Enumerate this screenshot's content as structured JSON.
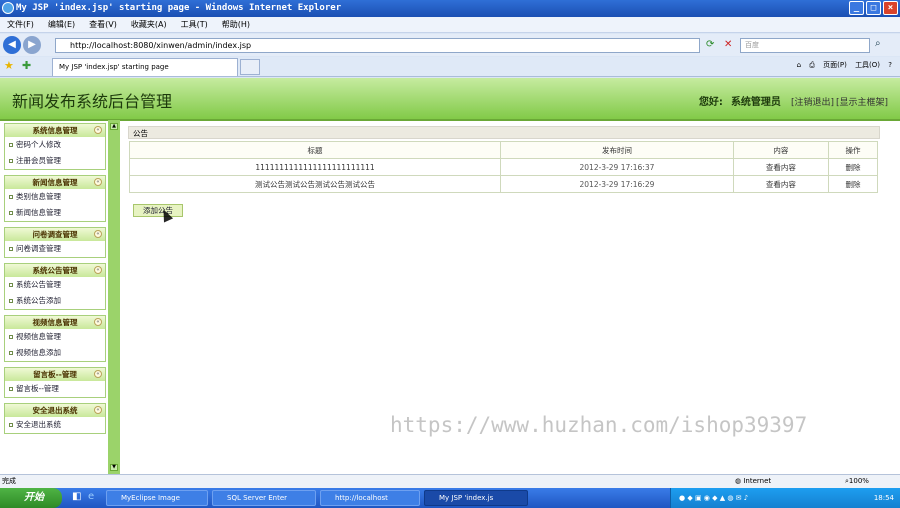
{
  "window": {
    "title": "My JSP 'index.jsp' starting page - Windows Internet Explorer"
  },
  "menu": [
    "文件(F)",
    "编辑(E)",
    "查看(V)",
    "收藏夹(A)",
    "工具(T)",
    "帮助(H)"
  ],
  "address": {
    "url": "http://localhost:8080/xinwen/admin/index.jsp",
    "search_placeholder": "百度"
  },
  "tab": {
    "label": "My JSP 'index.jsp' starting page"
  },
  "commands": {
    "page": "页面(P)",
    "tools": "工具(O)"
  },
  "header": {
    "title": "新闻发布系统后台管理",
    "greeting": "您好:",
    "user": "系统管理员",
    "logout": "[注销退出]",
    "home": "[显示主框架]"
  },
  "sidebar": [
    {
      "title": "系统信息管理",
      "items": [
        "密码个人修改",
        "注册会员管理"
      ]
    },
    {
      "title": "新闻信息管理",
      "items": [
        "类别信息管理",
        "新闻信息管理"
      ]
    },
    {
      "title": "问卷调查管理",
      "items": [
        "问卷调查管理"
      ]
    },
    {
      "title": "系统公告管理",
      "items": [
        "系统公告管理",
        "系统公告添加"
      ]
    },
    {
      "title": "视频信息管理",
      "items": [
        "视频信息管理",
        "视频信息添加"
      ]
    },
    {
      "title": "留言板--管理",
      "items": [
        "留言板--管理"
      ]
    },
    {
      "title": "安全退出系统",
      "items": [
        "安全退出系统"
      ]
    }
  ],
  "panel": {
    "title": "公告",
    "add_button": "添加公告"
  },
  "table": {
    "headers": [
      "标题",
      "发布时间",
      "内容",
      "操作"
    ],
    "rows": [
      [
        "1111111111111111111111111",
        "2012-3-29 17:16:37",
        "查看内容",
        "删除"
      ],
      [
        "测试公告测试公告测试公告测试公告",
        "2012-3-29 17:16:29",
        "查看内容",
        "删除"
      ]
    ]
  },
  "watermark": "https://www.huzhan.com/ishop39397",
  "status": {
    "left": "完成",
    "zone": "Internet",
    "zoom": "100%"
  },
  "taskbar": {
    "start": "开始",
    "buttons": [
      "MyEclipse Image",
      "SQL Server Enter",
      "http://localhost",
      "My JSP 'index.js"
    ],
    "clock": "18:54"
  }
}
